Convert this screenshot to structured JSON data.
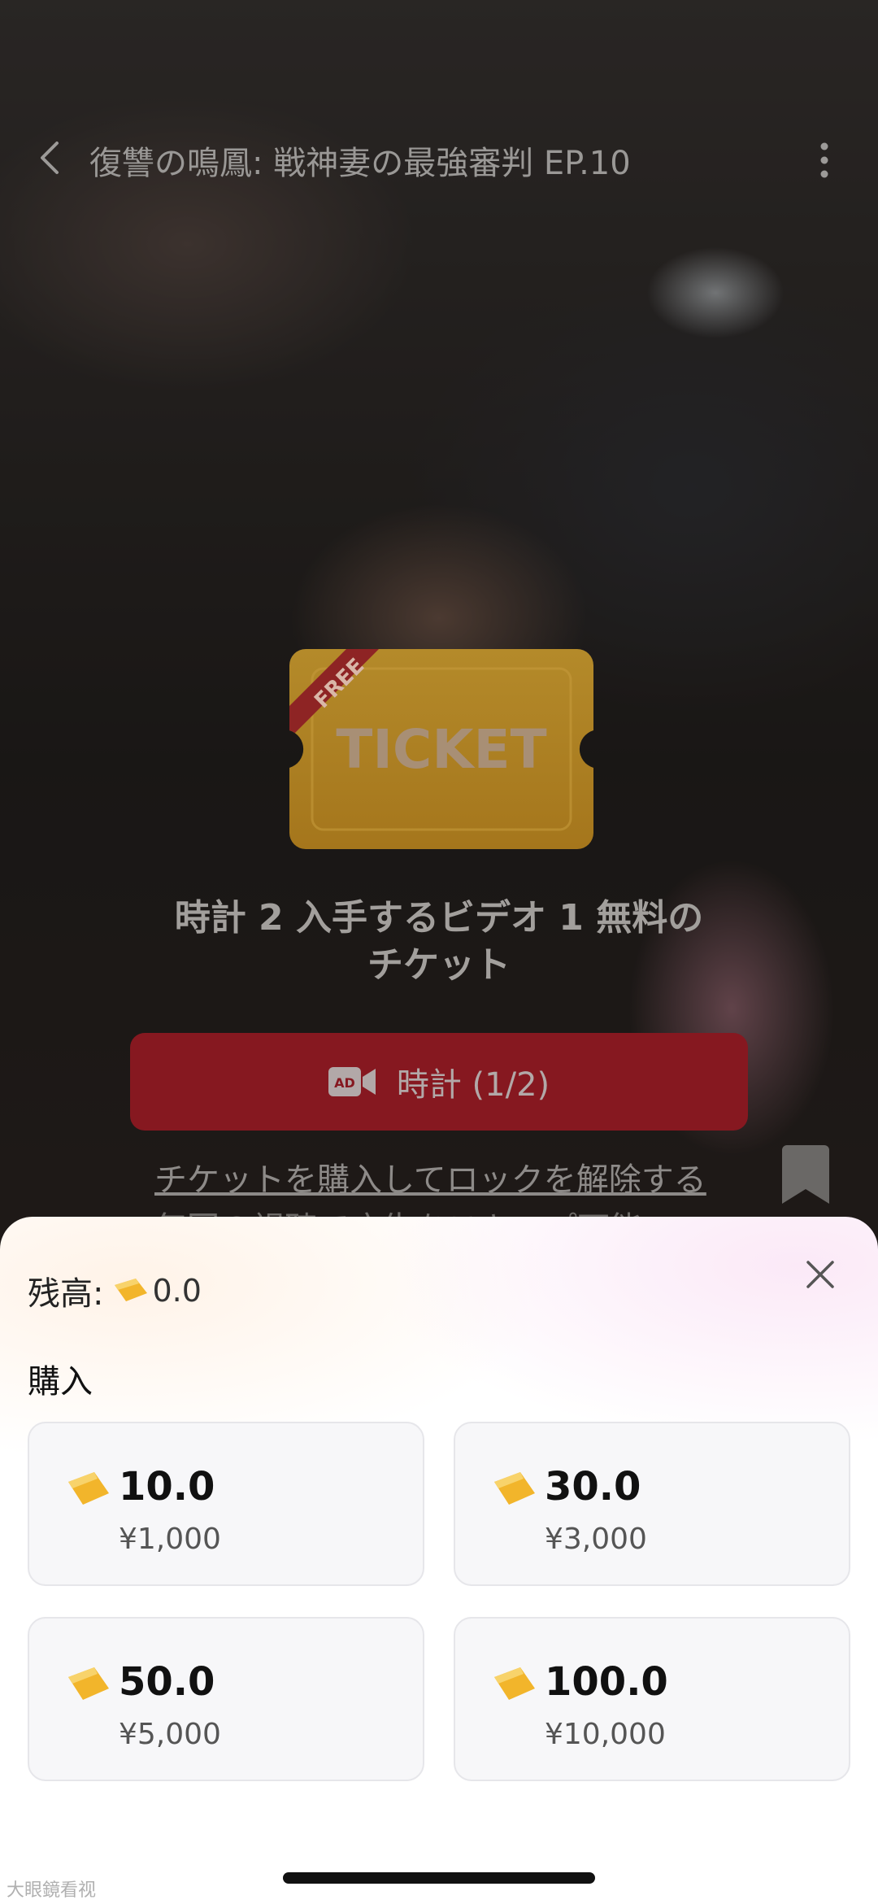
{
  "header": {
    "back_icon": "chevron-left-icon",
    "title": "復讐の鳴鳳: 戦神妻の最強審判 EP.10",
    "more_icon": "vertical-ellipsis-icon"
  },
  "ticket_graphic": {
    "ribbon_text": "FREE",
    "ticket_text": "TICKET"
  },
  "promo": {
    "headline_line1": "時計 2 入手するビデオ 1 無料の",
    "headline_line2": "チケット",
    "watch_button_label": "時計 (1/2)",
    "watch_button_icon": "ad-video-icon",
    "unlock_link": "チケットを購入してロックを解除する",
    "unlock_next_text": "毎回の視聴で広告をスキップ可能"
  },
  "bookmark_icon": "bookmark-icon",
  "sheet": {
    "balance_label": "残高:",
    "balance_value": "0.0",
    "close_icon": "close-icon",
    "purchase_label": "購入",
    "options": [
      {
        "amount": "10.0",
        "price": "¥1,000"
      },
      {
        "amount": "30.0",
        "price": "¥3,000"
      },
      {
        "amount": "50.0",
        "price": "¥5,000"
      },
      {
        "amount": "100.0",
        "price": "¥10,000"
      }
    ]
  },
  "watermark": "大眼鏡看视",
  "colors": {
    "accent_red": "#861820",
    "ticket_gold": "#f2b52b",
    "ribbon_red": "#c0302c"
  }
}
